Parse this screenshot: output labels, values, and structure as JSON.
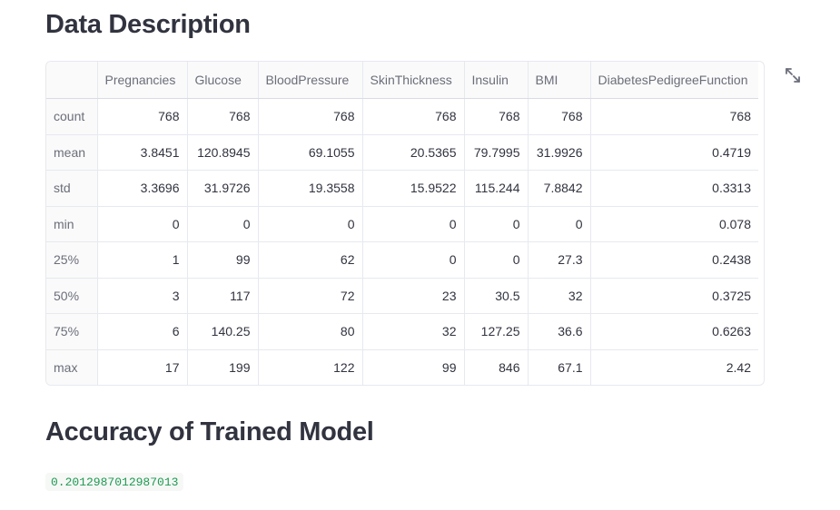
{
  "data_description": {
    "title": "Data Description"
  },
  "table": {
    "columns": [
      "",
      "Pregnancies",
      "Glucose",
      "BloodPressure",
      "SkinThickness",
      "Insulin",
      "BMI",
      "DiabetesPedigreeFunction"
    ],
    "rows": [
      [
        "count",
        "768",
        "768",
        "768",
        "768",
        "768",
        "768",
        "768"
      ],
      [
        "mean",
        "3.8451",
        "120.8945",
        "69.1055",
        "20.5365",
        "79.7995",
        "31.9926",
        "0.4719"
      ],
      [
        "std",
        "3.3696",
        "31.9726",
        "19.3558",
        "15.9522",
        "115.244",
        "7.8842",
        "0.3313"
      ],
      [
        "min",
        "0",
        "0",
        "0",
        "0",
        "0",
        "0",
        "0.078"
      ],
      [
        "25%",
        "1",
        "99",
        "62",
        "0",
        "0",
        "27.3",
        "0.2438"
      ],
      [
        "50%",
        "3",
        "117",
        "72",
        "23",
        "30.5",
        "32",
        "0.3725"
      ],
      [
        "75%",
        "6",
        "140.25",
        "80",
        "32",
        "127.25",
        "36.6",
        "0.6263"
      ],
      [
        "max",
        "17",
        "199",
        "122",
        "99",
        "846",
        "67.1",
        "2.42"
      ]
    ]
  },
  "expand_icon": "expand-icon",
  "accuracy": {
    "title": "Accuracy of Trained Model",
    "value": "0.2012987012987013"
  },
  "colors": {
    "accent_code": "#1f9a52",
    "text": "#31333f",
    "muted": "#6b6e7a",
    "border": "#e6e9ef"
  }
}
